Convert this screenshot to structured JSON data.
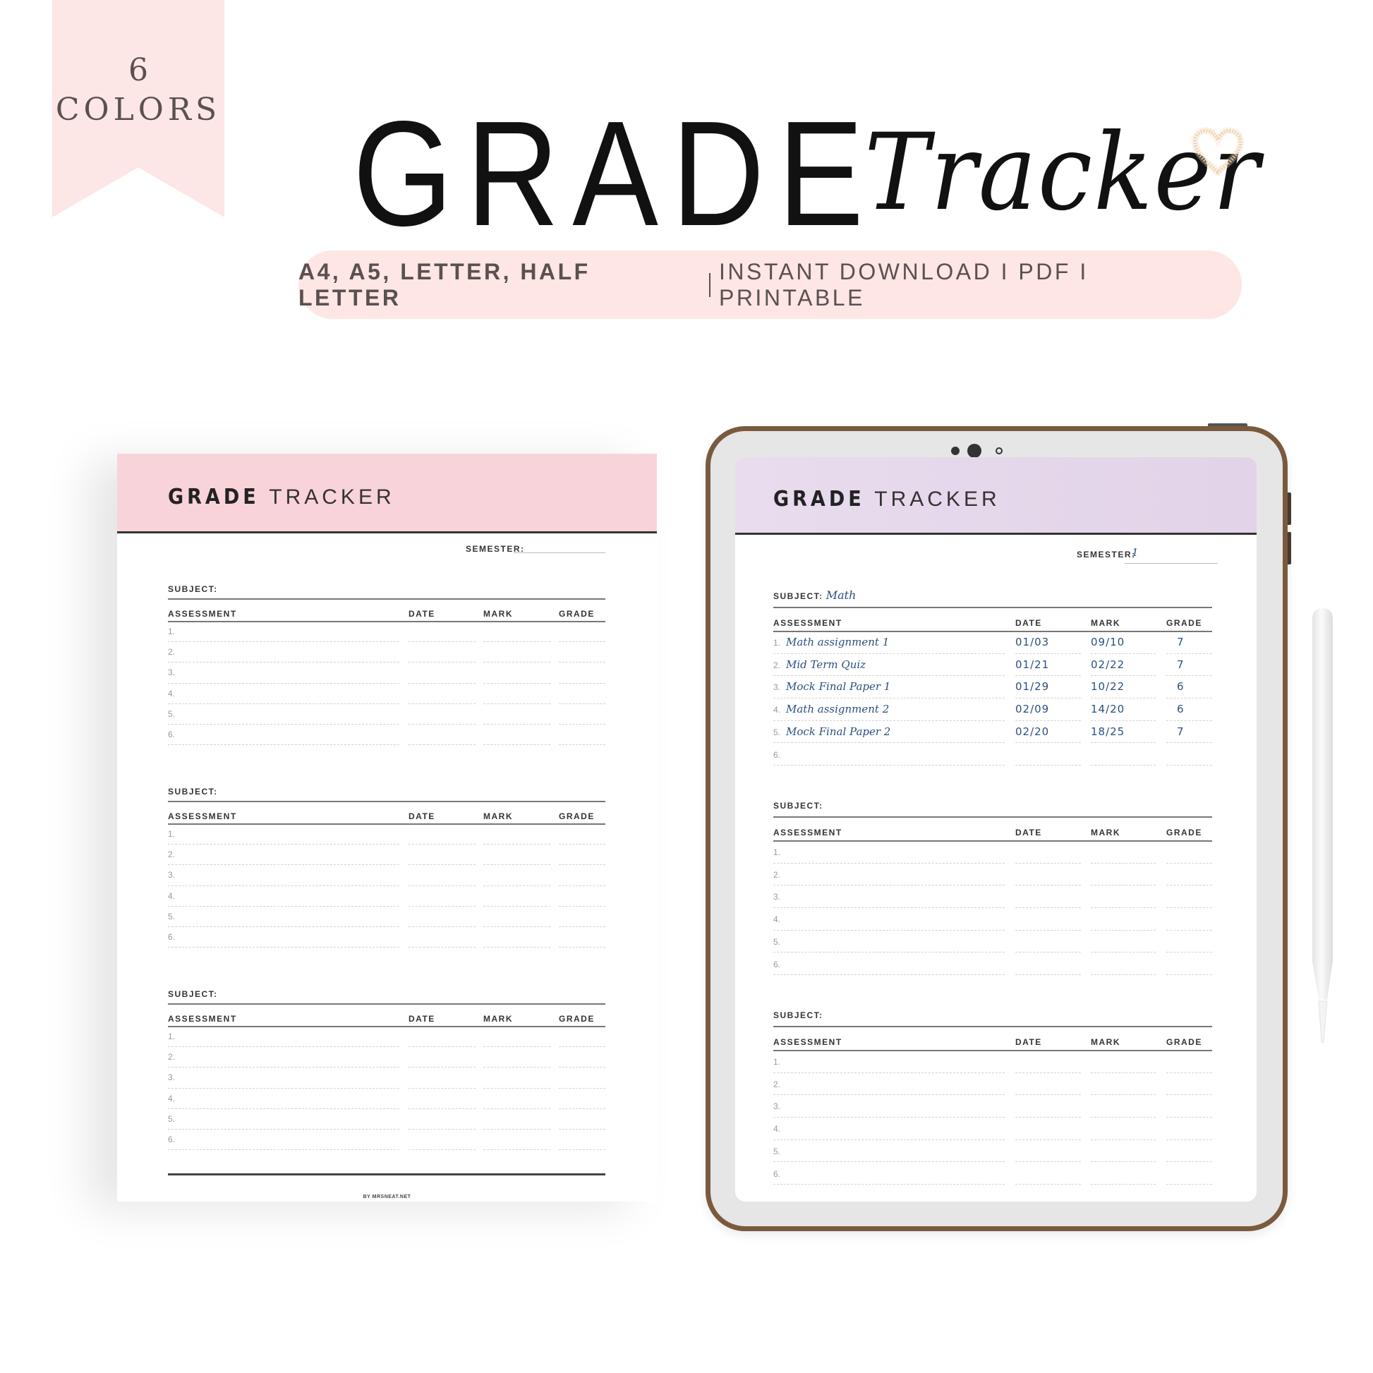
{
  "badge": {
    "count": "6",
    "label": "COLORS"
  },
  "title": {
    "main": "GRADE",
    "script": "Tracker"
  },
  "decoration": {
    "heart_icon": "sparkle-heart"
  },
  "tagline": {
    "formats": "A4, A5, LETTER, HALF LETTER",
    "features": "INSTANT DOWNLOAD I PDF I PRINTABLE"
  },
  "colors": {
    "ribbon": "#fce6e6",
    "pill": "#fde6e4",
    "pink_header": "#f9d3da",
    "lavender_header": "#e6d9ec",
    "tablet_frame": "#7a5a3e",
    "ink": "#2b4f7e"
  },
  "printable_page": {
    "header": {
      "bold": "GRADE",
      "light": "TRACKER"
    },
    "semester_label": "SEMESTER:",
    "semester_value": "",
    "sections": [
      {
        "subject_label": "SUBJECT:",
        "subject_value": "",
        "columns": [
          "ASSESSMENT",
          "DATE",
          "MARK",
          "GRADE"
        ],
        "rows": [
          {
            "n": "1."
          },
          {
            "n": "2."
          },
          {
            "n": "3."
          },
          {
            "n": "4."
          },
          {
            "n": "5."
          },
          {
            "n": "6."
          }
        ]
      },
      {
        "subject_label": "SUBJECT:",
        "subject_value": "",
        "columns": [
          "ASSESSMENT",
          "DATE",
          "MARK",
          "GRADE"
        ],
        "rows": [
          {
            "n": "1."
          },
          {
            "n": "2."
          },
          {
            "n": "3."
          },
          {
            "n": "4."
          },
          {
            "n": "5."
          },
          {
            "n": "6."
          }
        ]
      },
      {
        "subject_label": "SUBJECT:",
        "subject_value": "",
        "columns": [
          "ASSESSMENT",
          "DATE",
          "MARK",
          "GRADE"
        ],
        "rows": [
          {
            "n": "1."
          },
          {
            "n": "2."
          },
          {
            "n": "3."
          },
          {
            "n": "4."
          },
          {
            "n": "5."
          },
          {
            "n": "6."
          }
        ]
      }
    ],
    "footer": "BY MRSNEAT.NET"
  },
  "tablet_page": {
    "header": {
      "bold": "GRADE",
      "light": "TRACKER"
    },
    "semester_label": "SEMESTER:",
    "semester_value": "1",
    "sections": [
      {
        "subject_label": "SUBJECT:",
        "subject_value": "Math",
        "columns": [
          "ASSESSMENT",
          "DATE",
          "MARK",
          "GRADE"
        ],
        "rows": [
          {
            "n": "1.",
            "assessment": "Math assignment 1",
            "date": "01/03",
            "mark": "09/10",
            "grade": "7"
          },
          {
            "n": "2.",
            "assessment": "Mid Term Quiz",
            "date": "01/21",
            "mark": "02/22",
            "grade": "7"
          },
          {
            "n": "3.",
            "assessment": "Mock Final Paper 1",
            "date": "01/29",
            "mark": "10/22",
            "grade": "6"
          },
          {
            "n": "4.",
            "assessment": "Math assignment 2",
            "date": "02/09",
            "mark": "14/20",
            "grade": "6"
          },
          {
            "n": "5.",
            "assessment": "Mock Final Paper 2",
            "date": "02/20",
            "mark": "18/25",
            "grade": "7"
          },
          {
            "n": "6."
          }
        ]
      },
      {
        "subject_label": "SUBJECT:",
        "subject_value": "",
        "columns": [
          "ASSESSMENT",
          "DATE",
          "MARK",
          "GRADE"
        ],
        "rows": [
          {
            "n": "1."
          },
          {
            "n": "2."
          },
          {
            "n": "3."
          },
          {
            "n": "4."
          },
          {
            "n": "5."
          },
          {
            "n": "6."
          }
        ]
      },
      {
        "subject_label": "SUBJECT:",
        "subject_value": "",
        "columns": [
          "ASSESSMENT",
          "DATE",
          "MARK",
          "GRADE"
        ],
        "rows": [
          {
            "n": "1."
          },
          {
            "n": "2."
          },
          {
            "n": "3."
          },
          {
            "n": "4."
          },
          {
            "n": "5."
          },
          {
            "n": "6."
          }
        ]
      }
    ]
  }
}
